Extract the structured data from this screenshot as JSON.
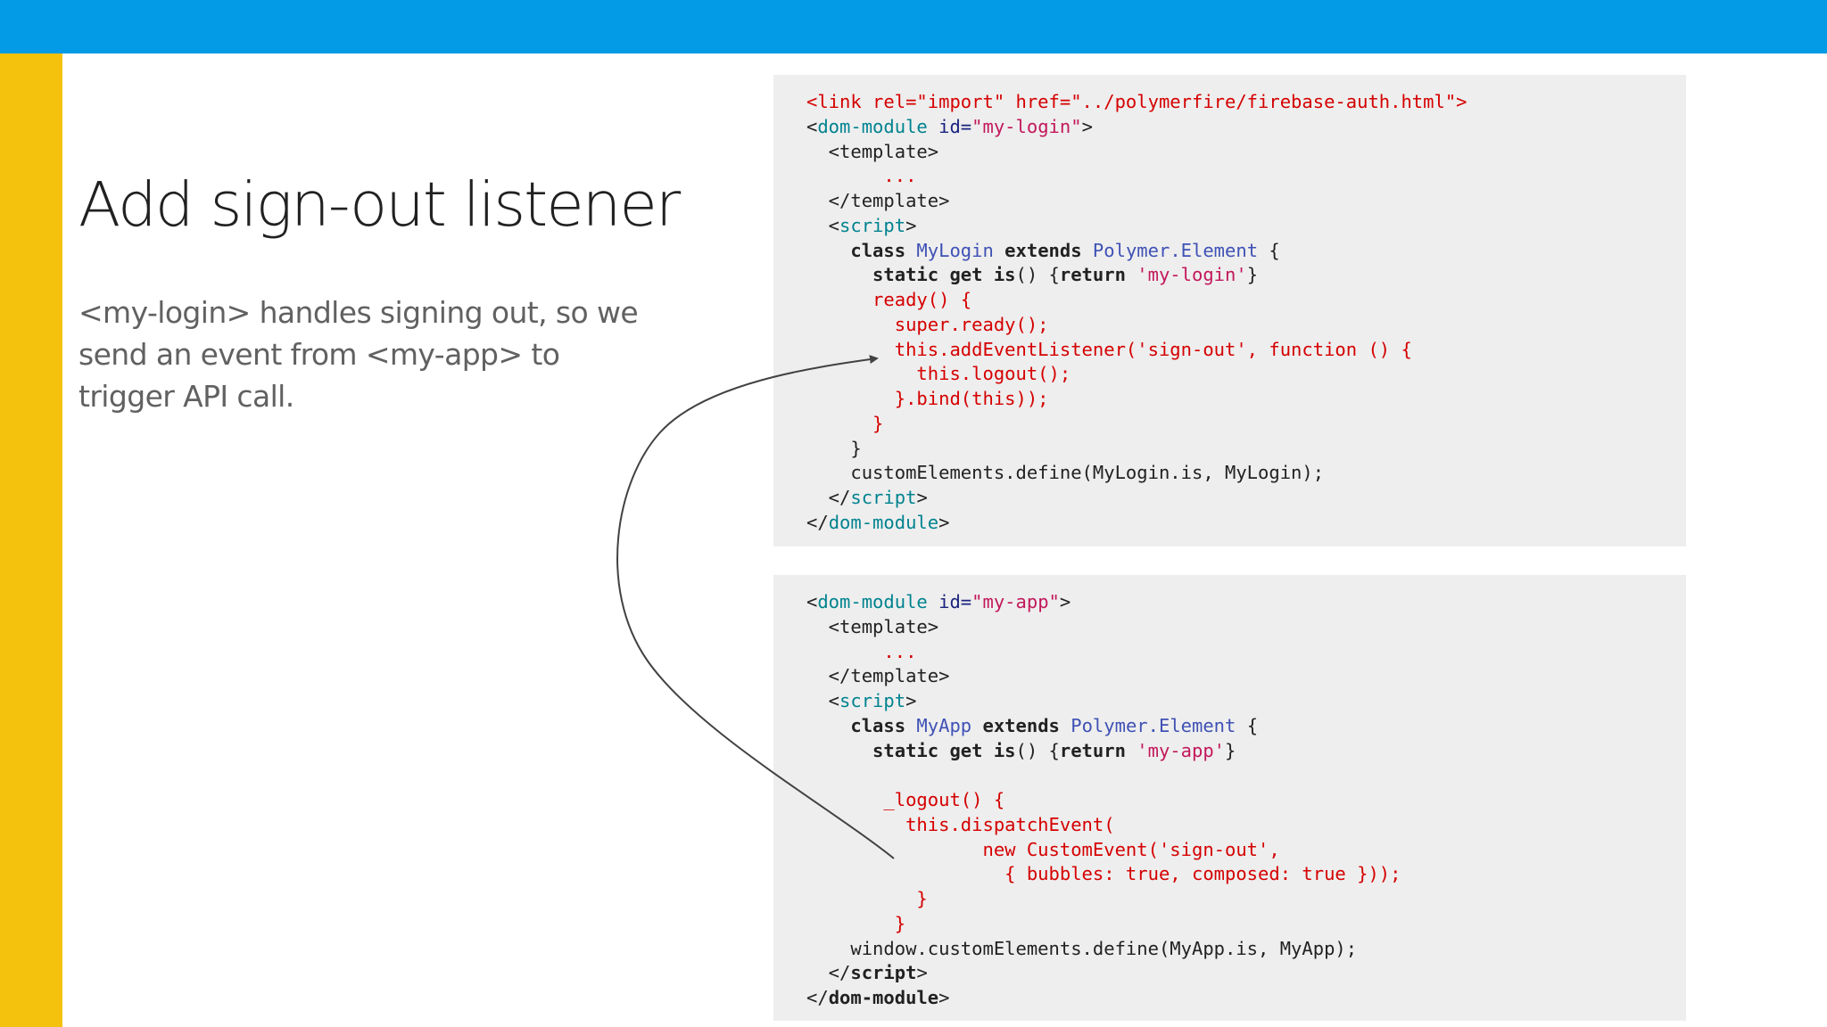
{
  "slide": {
    "title": "Add sign-out listener",
    "subtitle_lines": [
      "<my-login> handles signing out, so we",
      "send an event from <my-app> to",
      "trigger API call."
    ],
    "colors": {
      "top_bar": "#039BE5",
      "side_bar": "#F4C20D",
      "code_bg": "#eeeeee",
      "highlight": "#d50000"
    }
  },
  "code_blocks": [
    {
      "lines": [
        [
          {
            "t": "<link rel=\"import\" href=\"../polymerfire/firebase-auth.html\">",
            "c": "red"
          }
        ],
        [
          {
            "t": "<",
            "c": "plain"
          },
          {
            "t": "dom-module",
            "c": "tag"
          },
          {
            "t": " id=",
            "c": "attr"
          },
          {
            "t": "\"my-login\"",
            "c": "str"
          },
          {
            "t": ">",
            "c": "plain"
          }
        ],
        [
          {
            "t": "  <template>",
            "c": "plain"
          }
        ],
        [
          {
            "t": "       ...",
            "c": "red"
          }
        ],
        [
          {
            "t": "  </template>",
            "c": "plain"
          }
        ],
        [
          {
            "t": "  <",
            "c": "plain"
          },
          {
            "t": "script",
            "c": "tag"
          },
          {
            "t": ">",
            "c": "plain"
          }
        ],
        [
          {
            "t": "    class ",
            "c": "kw"
          },
          {
            "t": "MyLogin",
            "c": "cls"
          },
          {
            "t": " extends ",
            "c": "kw"
          },
          {
            "t": "Polymer.Element",
            "c": "cls"
          },
          {
            "t": " {",
            "c": "plain"
          }
        ],
        [
          {
            "t": "      static get is",
            "c": "kw"
          },
          {
            "t": "() {",
            "c": "plain"
          },
          {
            "t": "return",
            "c": "kw"
          },
          {
            "t": " ",
            "c": "plain"
          },
          {
            "t": "'my-login'",
            "c": "str"
          },
          {
            "t": "}",
            "c": "plain"
          }
        ],
        [
          {
            "t": "      ready() {",
            "c": "red"
          }
        ],
        [
          {
            "t": "        super.ready();",
            "c": "red"
          }
        ],
        [
          {
            "t": "        this.addEventListener('sign-out', function () {",
            "c": "red"
          }
        ],
        [
          {
            "t": "          this.logout();",
            "c": "red"
          }
        ],
        [
          {
            "t": "        }.bind(this));",
            "c": "red"
          }
        ],
        [
          {
            "t": "      }",
            "c": "red"
          }
        ],
        [
          {
            "t": "    }",
            "c": "plain"
          }
        ],
        [
          {
            "t": "    customElements.define(MyLogin.is, MyLogin);",
            "c": "plain"
          }
        ],
        [
          {
            "t": "  </",
            "c": "plain"
          },
          {
            "t": "script",
            "c": "tag"
          },
          {
            "t": ">",
            "c": "plain"
          }
        ],
        [
          {
            "t": "</",
            "c": "plain"
          },
          {
            "t": "dom-module",
            "c": "tag"
          },
          {
            "t": ">",
            "c": "plain"
          }
        ]
      ]
    },
    {
      "lines": [
        [
          {
            "t": "<",
            "c": "plain"
          },
          {
            "t": "dom-module",
            "c": "tag"
          },
          {
            "t": " id=",
            "c": "attr"
          },
          {
            "t": "\"my-app\"",
            "c": "str"
          },
          {
            "t": ">",
            "c": "plain"
          }
        ],
        [
          {
            "t": "  <template>",
            "c": "plain"
          }
        ],
        [
          {
            "t": "       ...",
            "c": "red"
          }
        ],
        [
          {
            "t": "  </template>",
            "c": "plain"
          }
        ],
        [
          {
            "t": "  <",
            "c": "plain"
          },
          {
            "t": "script",
            "c": "tag"
          },
          {
            "t": ">",
            "c": "plain"
          }
        ],
        [
          {
            "t": "    class ",
            "c": "kw"
          },
          {
            "t": "MyApp",
            "c": "cls"
          },
          {
            "t": " extends ",
            "c": "kw"
          },
          {
            "t": "Polymer.Element",
            "c": "cls"
          },
          {
            "t": " {",
            "c": "plain"
          }
        ],
        [
          {
            "t": "      static get is",
            "c": "kw"
          },
          {
            "t": "() {",
            "c": "plain"
          },
          {
            "t": "return",
            "c": "kw"
          },
          {
            "t": " ",
            "c": "plain"
          },
          {
            "t": "'my-app'",
            "c": "str"
          },
          {
            "t": "}",
            "c": "plain"
          }
        ],
        [
          {
            "t": "",
            "c": "plain"
          }
        ],
        [
          {
            "t": "       _logout() {",
            "c": "red"
          }
        ],
        [
          {
            "t": "         this.dispatchEvent(",
            "c": "red"
          }
        ],
        [
          {
            "t": "                new CustomEvent('sign-out',",
            "c": "red"
          }
        ],
        [
          {
            "t": "                  { bubbles: true, composed: true }));",
            "c": "red"
          }
        ],
        [
          {
            "t": "          }",
            "c": "red"
          }
        ],
        [
          {
            "t": "        }",
            "c": "red"
          }
        ],
        [
          {
            "t": "    window.customElements.define(MyApp.is, MyApp);",
            "c": "plain"
          }
        ],
        [
          {
            "t": "  </",
            "c": "plain"
          },
          {
            "t": "script",
            "c": "kw"
          },
          {
            "t": ">",
            "c": "plain"
          }
        ],
        [
          {
            "t": "</",
            "c": "plain"
          },
          {
            "t": "dom-module",
            "c": "kw"
          },
          {
            "t": ">",
            "c": "plain"
          }
        ]
      ]
    }
  ]
}
